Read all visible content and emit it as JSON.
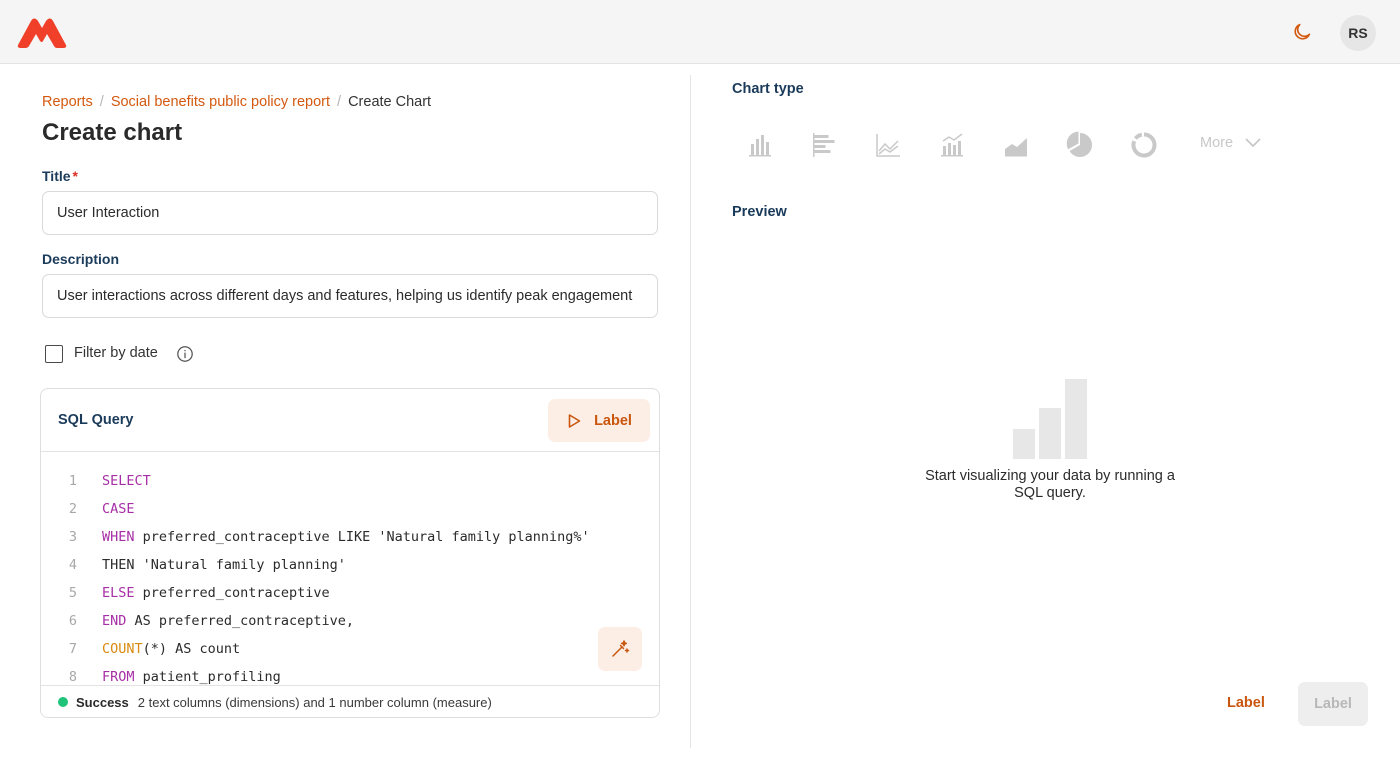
{
  "header": {
    "logo_icon": "brand-logo-icon",
    "theme_toggle_icon": "moon-icon",
    "avatar_initials": "RS",
    "brand_color": "#f0402a"
  },
  "breadcrumb": {
    "items": [
      "Reports",
      "Social benefits public policy report"
    ],
    "current": "Create Chart",
    "separator": "/"
  },
  "page_title": "Create chart",
  "form": {
    "title_label": "Title",
    "title_required_marker": "*",
    "title_value": "User Interaction",
    "description_label": "Description",
    "description_value": "User interactions across different days and features, helping us identify peak engagement",
    "filter_by_date_label": "Filter by date",
    "filter_by_date_checked": false
  },
  "sql_panel": {
    "title": "SQL Query",
    "run_button_label": "Label",
    "line_numbers": [
      "1",
      "2",
      "3",
      "4",
      "5",
      "6",
      "7",
      "8"
    ],
    "code_lines": [
      {
        "kw": "SELECT",
        "rest": ""
      },
      {
        "kw": "CASE",
        "rest": ""
      },
      {
        "kw": "WHEN",
        "rest": " preferred_contraceptive LIKE 'Natural family planning%'"
      },
      {
        "kw": "",
        "rest": "THEN 'Natural family planning'"
      },
      {
        "kw": "ELSE",
        "rest": " preferred_contraceptive"
      },
      {
        "kw": "END",
        "rest": " AS preferred_contraceptive,"
      },
      {
        "fn": "COUNT",
        "rest": "(*) AS count"
      },
      {
        "kw": "FROM",
        "rest": " patient_profiling"
      }
    ],
    "status_label": "Success",
    "status_message": "2 text columns (dimensions) and 1 number column (measure)",
    "status_color": "#1fc47a"
  },
  "chart_type": {
    "label": "Chart type",
    "icons": [
      "bar-chart-icon",
      "horizontal-bar-chart-icon",
      "line-chart-icon",
      "combo-chart-icon",
      "area-chart-icon",
      "pie-chart-icon",
      "donut-chart-icon"
    ],
    "more_label": "More"
  },
  "preview": {
    "label": "Preview",
    "empty_message": "Start visualizing your data by running a SQL query."
  },
  "footer": {
    "secondary_label": "Label",
    "primary_label": "Label"
  },
  "colors": {
    "accent": "#d4590f",
    "heading": "#1b3b5a",
    "keyword": "#a62ea6",
    "function": "#d98a10"
  }
}
